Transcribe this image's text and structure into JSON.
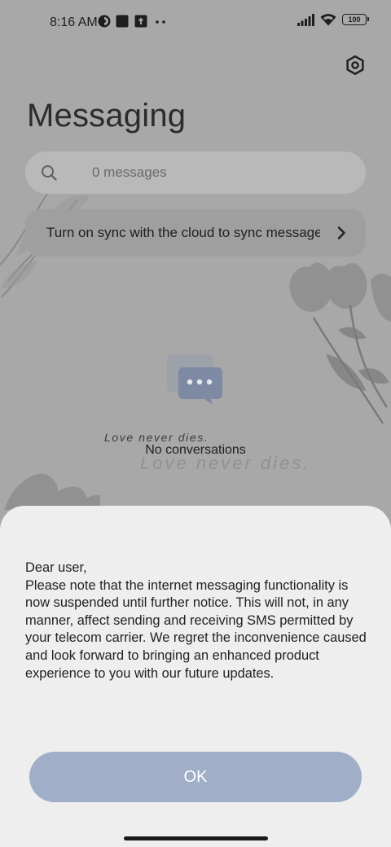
{
  "status_bar": {
    "time": "8:16 AM",
    "icons": [
      "app-notification-icon",
      "square-notification-icon",
      "upload-notification-icon",
      "more-notifications-icon"
    ],
    "right_icons": [
      "signal-icon",
      "wifi-icon",
      "battery-icon"
    ],
    "battery_level": "100"
  },
  "header": {
    "title": "Messaging",
    "settings_icon": "settings-hexagon-icon"
  },
  "search": {
    "text": "0 messages",
    "icon": "search-icon"
  },
  "sync_banner": {
    "text": "Turn on sync with the cloud to sync messages",
    "chevron_icon": "chevron-right-icon"
  },
  "empty_state": {
    "icon": "chat-bubbles-icon",
    "text": "No conversations",
    "decoration_text_1": "Love never dies.",
    "decoration_text_2": "Love never dies."
  },
  "dialog": {
    "message": "Dear user,\nPlease note that the internet messaging functionality is now suspended until further notice. This will not, in any manner, affect sending and receiving SMS permitted by your telecom carrier. We regret the inconvenience caused and look forward to bringing an enhanced product experience to you with our future updates.",
    "ok_label": "OK"
  },
  "colors": {
    "background_dimmed": "#a8a8a8",
    "dialog_background": "#eeeeee",
    "ok_button": "#a1aec8",
    "chat_icon": "#7e8aa4"
  }
}
